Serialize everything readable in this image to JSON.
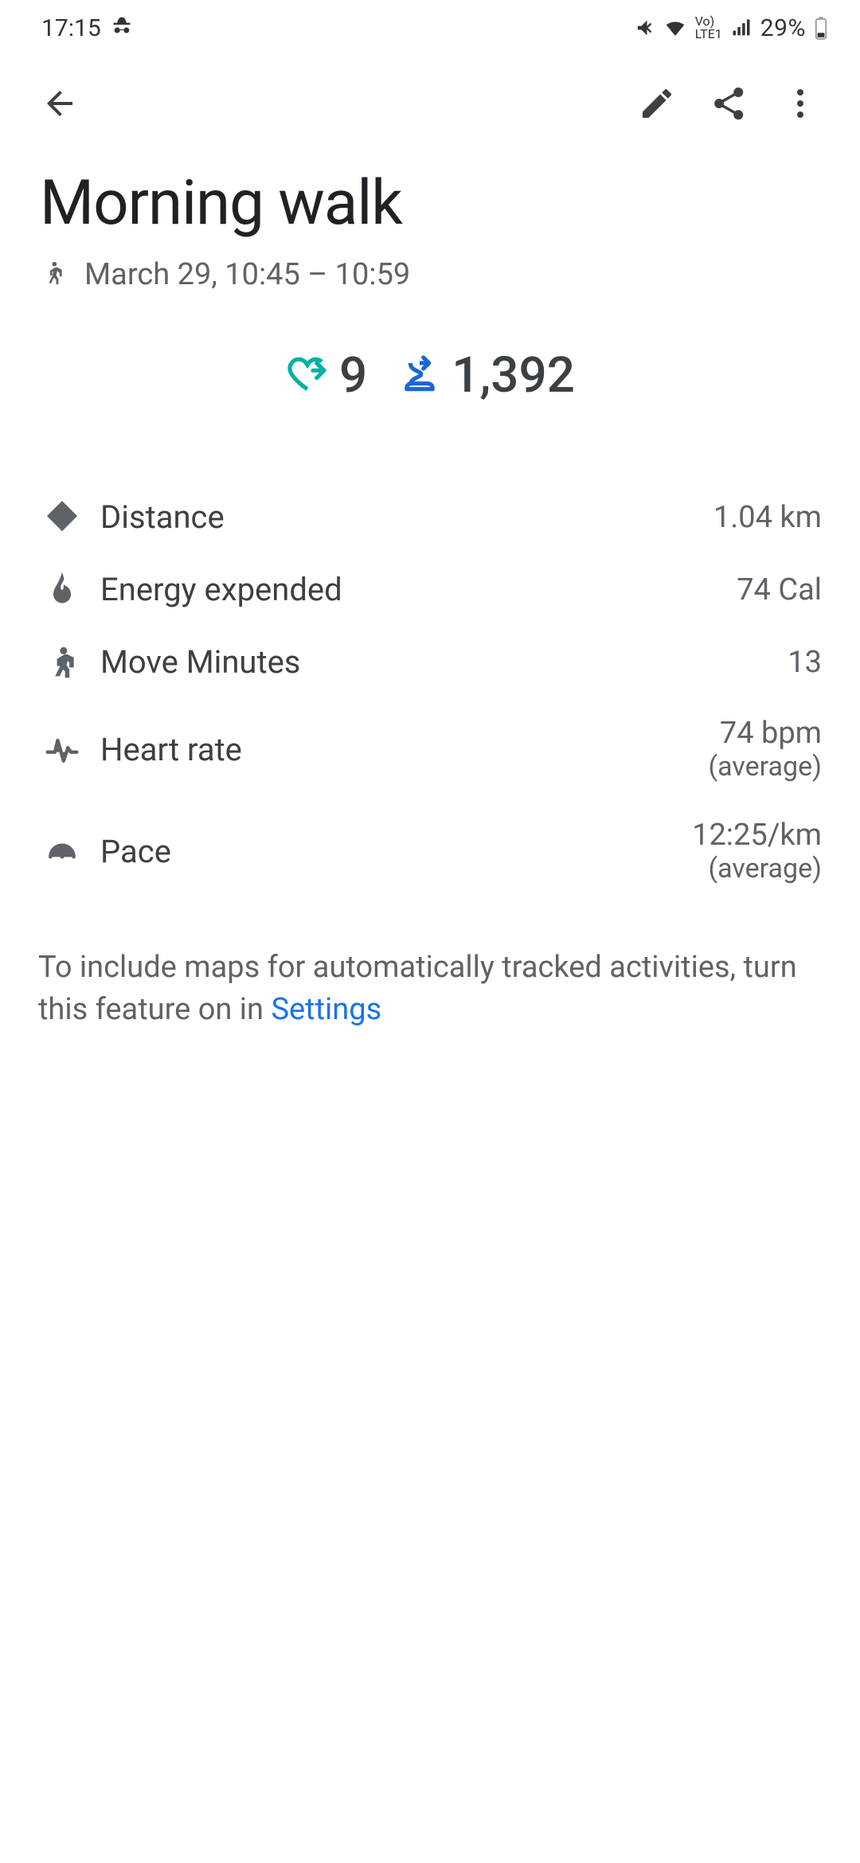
{
  "status": {
    "time": "17:15",
    "battery_pct": "29%"
  },
  "header": {
    "title": "Morning walk",
    "subtitle": "March 29, 10:45 – 10:59"
  },
  "summary": {
    "heart_points": "9",
    "steps": "1,392"
  },
  "stats": {
    "distance": {
      "label": "Distance",
      "value": "1.04 km"
    },
    "energy": {
      "label": "Energy expended",
      "value": "74 Cal"
    },
    "move": {
      "label": "Move Minutes",
      "value": "13"
    },
    "heart": {
      "label": "Heart rate",
      "value": "74 bpm",
      "sub": "(average)"
    },
    "pace": {
      "label": "Pace",
      "value": "12:25/km",
      "sub": "(average)"
    }
  },
  "map_note": {
    "text": "To include maps for automatically tracked activities, turn this feature on in ",
    "link": "Settings"
  }
}
